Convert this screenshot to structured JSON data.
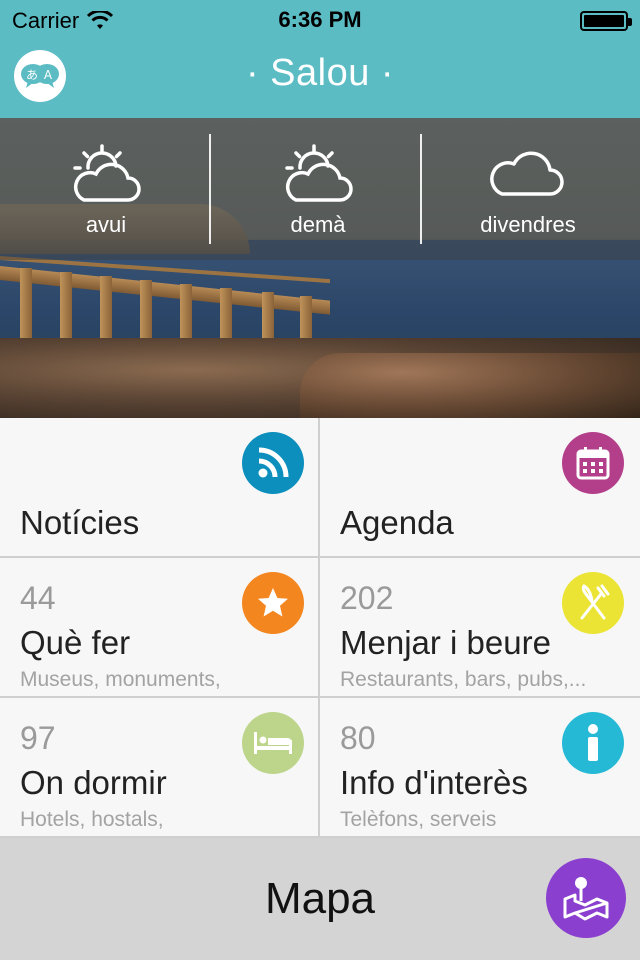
{
  "status_bar": {
    "carrier": "Carrier",
    "time": "6:36 PM"
  },
  "nav": {
    "title": "· Salou ·",
    "language_icon": "translate-icon"
  },
  "weather": [
    {
      "label": "avui",
      "icon": "partly-sunny-icon"
    },
    {
      "label": "demà",
      "icon": "partly-sunny-icon"
    },
    {
      "label": "divendres",
      "icon": "cloud-icon"
    }
  ],
  "tiles": {
    "news": {
      "title": "Notícies",
      "icon": "rss-icon",
      "color": "#0c8fbd"
    },
    "agenda": {
      "title": "Agenda",
      "icon": "calendar-icon",
      "color": "#b33f8a"
    },
    "todo": {
      "count": "44",
      "title": "Què fer",
      "subtitle": "Museus, monuments,",
      "icon": "star-icon",
      "color": "#f3861f"
    },
    "food": {
      "count": "202",
      "title": "Menjar i beure",
      "subtitle": "Restaurants, bars, pubs,...",
      "icon": "cutlery-icon",
      "color": "#ebe434"
    },
    "sleep": {
      "count": "97",
      "title": "On dormir",
      "subtitle": "Hotels, hostals,",
      "icon": "bed-icon",
      "color": "#bdd58a"
    },
    "info": {
      "count": "80",
      "title": "Info d'interès",
      "subtitle": "Telèfons, serveis",
      "icon": "info-icon",
      "color": "#26b9d5"
    }
  },
  "map": {
    "label": "Mapa",
    "icon": "map-pin-icon",
    "color": "#8a3fcf"
  }
}
